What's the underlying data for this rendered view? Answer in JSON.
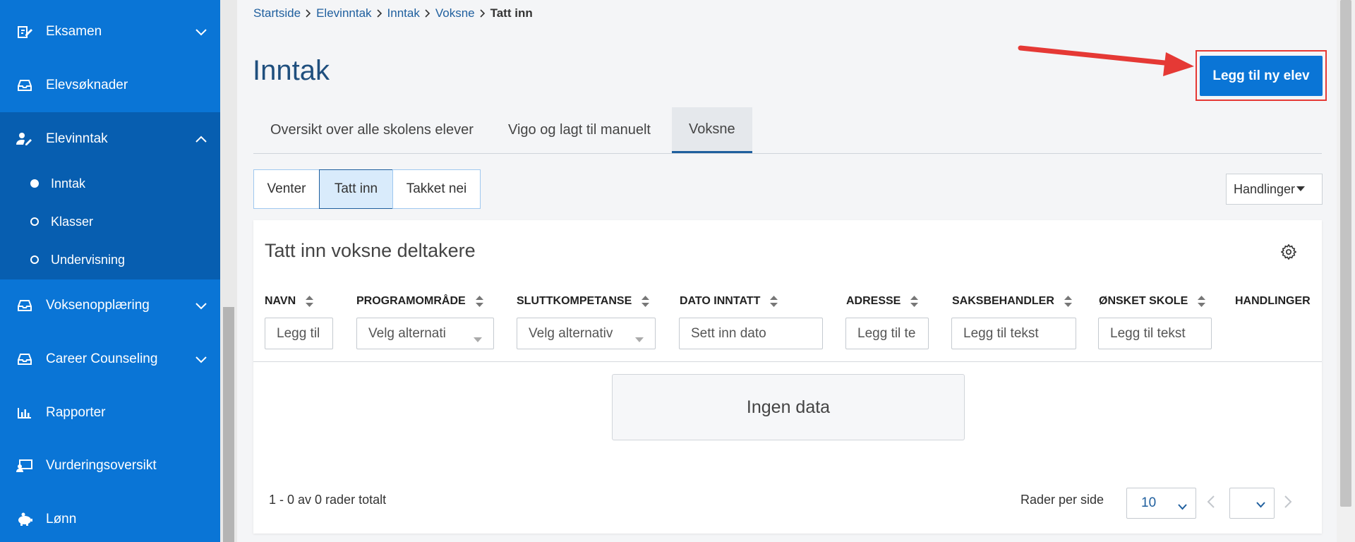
{
  "sidebar": {
    "items": [
      {
        "label": "Eksamen",
        "icon": "edit-note-icon"
      },
      {
        "label": "Elevsøknader",
        "icon": "inbox-icon"
      },
      {
        "label": "Elevinntak",
        "icon": "user-edit-icon"
      },
      {
        "label": "Voksenopplæring",
        "icon": "inbox-icon"
      },
      {
        "label": "Career Counseling",
        "icon": "inbox-icon"
      },
      {
        "label": "Rapporter",
        "icon": "bar-chart-icon"
      },
      {
        "label": "Vurderingsoversikt",
        "icon": "monitor-user-icon"
      },
      {
        "label": "Lønn",
        "icon": "piggy-bank-icon"
      }
    ],
    "subitems": [
      {
        "label": "Inntak",
        "active": true
      },
      {
        "label": "Klasser",
        "active": false
      },
      {
        "label": "Undervisning",
        "active": false
      }
    ]
  },
  "breadcrumb": [
    "Startside",
    "Elevinntak",
    "Inntak",
    "Voksne",
    "Tatt inn"
  ],
  "page": {
    "title": "Inntak",
    "add_button": "Legg til ny elev"
  },
  "tabs": [
    {
      "label": "Oversikt over alle skolens elever",
      "active": false
    },
    {
      "label": "Vigo og lagt til manuelt",
      "active": false
    },
    {
      "label": "Voksne",
      "active": true
    }
  ],
  "segments": [
    {
      "label": "Venter",
      "active": false
    },
    {
      "label": "Tatt inn",
      "active": true
    },
    {
      "label": "Takket nei",
      "active": false
    }
  ],
  "actions_button": "Handlinger",
  "table": {
    "title": "Tatt inn voksne deltakere",
    "columns": [
      {
        "label": "NAVN",
        "filter_placeholder": "Legg til",
        "filter_type": "text"
      },
      {
        "label": "PROGRAMOMRÅDE",
        "filter_placeholder": "Velg alternati",
        "filter_type": "select"
      },
      {
        "label": "SLUTTKOMPETANSE",
        "filter_placeholder": "Velg alternativ",
        "filter_type": "select"
      },
      {
        "label": "DATO INNTATT",
        "filter_placeholder": "Sett inn dato",
        "filter_type": "date"
      },
      {
        "label": "ADRESSE",
        "filter_placeholder": "Legg til te",
        "filter_type": "text"
      },
      {
        "label": "SAKSBEHANDLER",
        "filter_placeholder": "Legg til tekst",
        "filter_type": "text"
      },
      {
        "label": "ØNSKET SKOLE",
        "filter_placeholder": "Legg til tekst",
        "filter_type": "text"
      },
      {
        "label": "HANDLINGER"
      }
    ],
    "empty_text": "Ingen data",
    "count_text": "1 - 0 av 0 rader totalt",
    "rows_per_page_label": "Rader per side",
    "rows_per_page_value": "10",
    "page_value": ""
  },
  "colors": {
    "sidebar": "#0a75d6",
    "sidebar_group": "#075eb0",
    "primary": "#0a75d6",
    "highlight_red": "#e53935"
  }
}
